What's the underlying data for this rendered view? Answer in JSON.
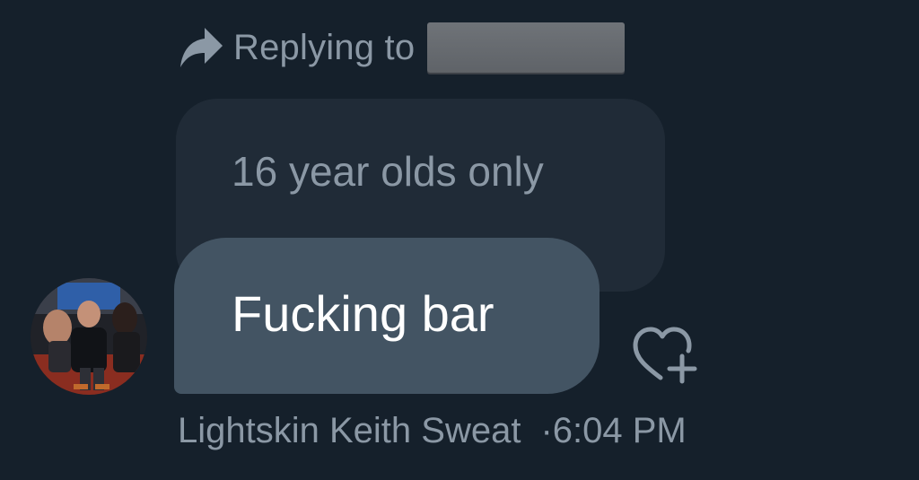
{
  "reply": {
    "prefix": "Replying to",
    "recipient_redacted": true,
    "icon": "reply-arrow-icon"
  },
  "quoted_message": {
    "text": "16 year olds only"
  },
  "message": {
    "text": "Fucking bar",
    "sender": "Lightskin Keith Sweat",
    "separator": "·",
    "time": "6:04 PM"
  },
  "actions": {
    "react_icon": "heart-plus-icon"
  },
  "colors": {
    "background": "#15202b",
    "quoted_bubble": "#202b37",
    "message_bubble": "#435463",
    "muted_text": "#8b98a5",
    "message_text": "#ffffff"
  }
}
